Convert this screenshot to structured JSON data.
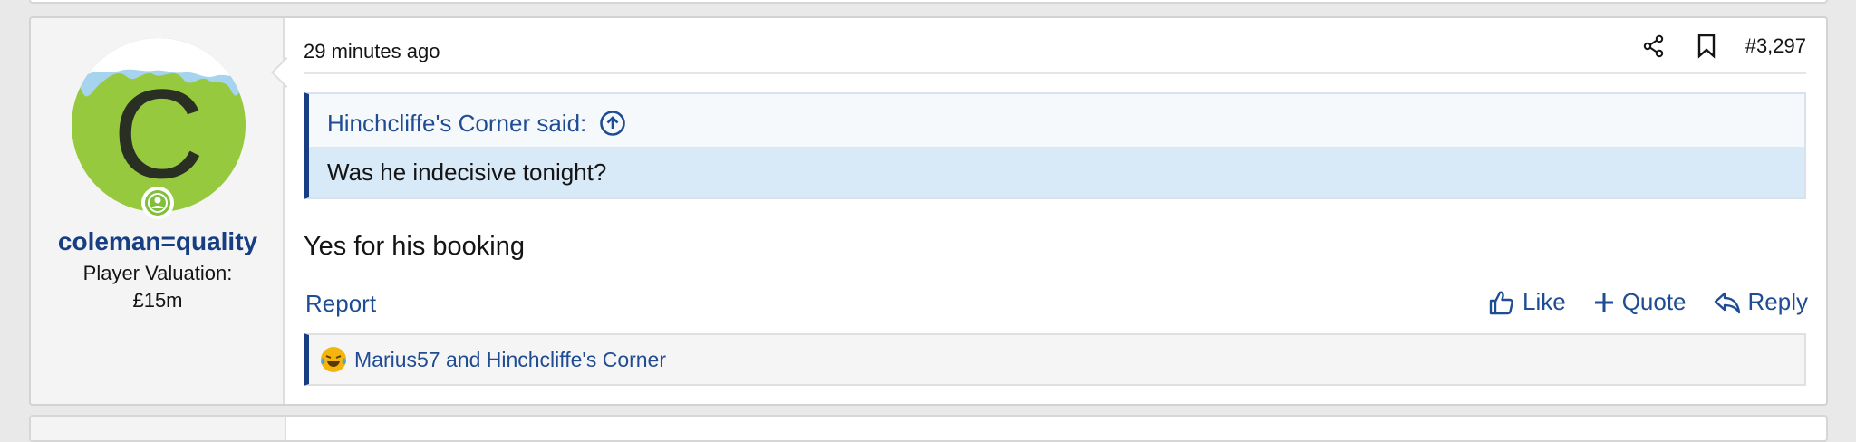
{
  "post": {
    "user": {
      "avatar_letter": "C",
      "avatar_color": "#97c93e",
      "username": "coleman=quality",
      "title_line1": "Player Valuation:",
      "title_line2": "£15m"
    },
    "time": "29 minutes ago",
    "post_number": "#3,297",
    "header_icons": [
      "share-icon",
      "bookmark-icon"
    ],
    "quote": {
      "author_said": "Hinchcliffe's Corner said:",
      "text": "Was he indecisive tonight?"
    },
    "message": "Yes for his booking",
    "report_label": "Report",
    "actions": {
      "like": "Like",
      "quote": "Quote",
      "reply": "Reply"
    },
    "reactions": {
      "emoji": "laughing-crying-icon",
      "names": "Marius57 and Hinchcliffe's Corner"
    }
  },
  "colors": {
    "link": "#1f4c93",
    "username": "#173d82",
    "quote_body_bg": "#d8e9f7",
    "accent_bar": "#173d82"
  }
}
